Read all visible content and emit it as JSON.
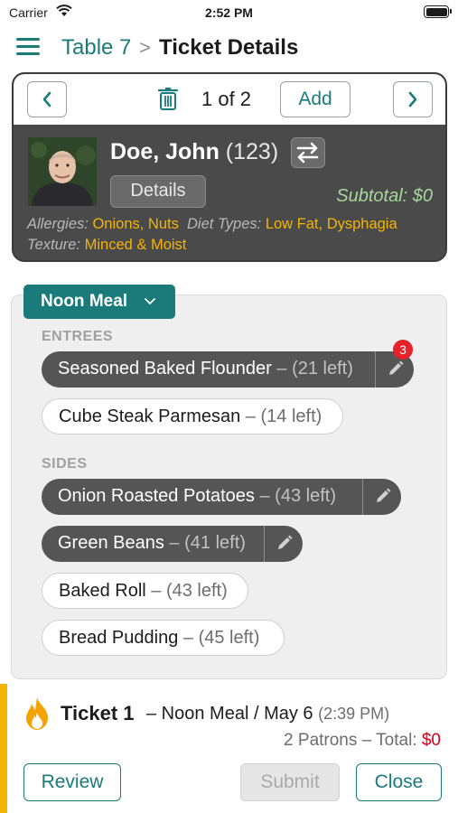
{
  "status_bar": {
    "carrier": "Carrier",
    "time": "2:52 PM"
  },
  "nav": {
    "breadcrumb": "Table 7",
    "separator": ">",
    "title": "Ticket Details"
  },
  "pager": {
    "count": "1 of 2",
    "add_label": "Add"
  },
  "patient": {
    "name": "Doe, John",
    "id": "(123)",
    "details_label": "Details",
    "subtotal": "Subtotal: $0",
    "allergies_label": "Allergies:",
    "allergies_value": "Onions, Nuts",
    "diet_label": "Diet Types:",
    "diet_value": "Low Fat, Dysphagia",
    "texture_label": "Texture:",
    "texture_value": "Minced & Moist"
  },
  "meal": {
    "selector_label": "Noon Meal",
    "entrees_label": "ENTREES",
    "sides_label": "SIDES",
    "entrees": [
      {
        "name": "Seasoned Baked Flounder",
        "left": "(21 left)",
        "badge": "3"
      },
      {
        "name": "Cube Steak Parmesan",
        "left": "(14 left)"
      }
    ],
    "sides": [
      {
        "name": "Onion Roasted Potatoes",
        "left": "(43 left)"
      },
      {
        "name": "Green Beans",
        "left": "(41 left)"
      },
      {
        "name": "Baked Roll",
        "left": "(43 left)"
      },
      {
        "name": "Bread Pudding",
        "left": "(45 left)"
      }
    ],
    "dash": "–"
  },
  "ticket": {
    "name": "Ticket 1",
    "meal_date": "– Noon Meal / May 6",
    "time": "(2:39 PM)",
    "patrons": "2 Patrons – Total:",
    "total": "$0",
    "review_label": "Review",
    "submit_label": "Submit",
    "close_label": "Close"
  },
  "colors": {
    "accent": "#1b7a7a",
    "highlight": "#f5b400",
    "card_bg": "#4a4a4a",
    "badge": "#e8212b"
  },
  "icons": [
    "wifi-icon",
    "battery-icon",
    "menu-icon",
    "chevron-left-icon",
    "trash-icon",
    "chevron-right-icon",
    "swap-icon",
    "chevron-down-icon",
    "pencil-icon",
    "flame-icon"
  ]
}
